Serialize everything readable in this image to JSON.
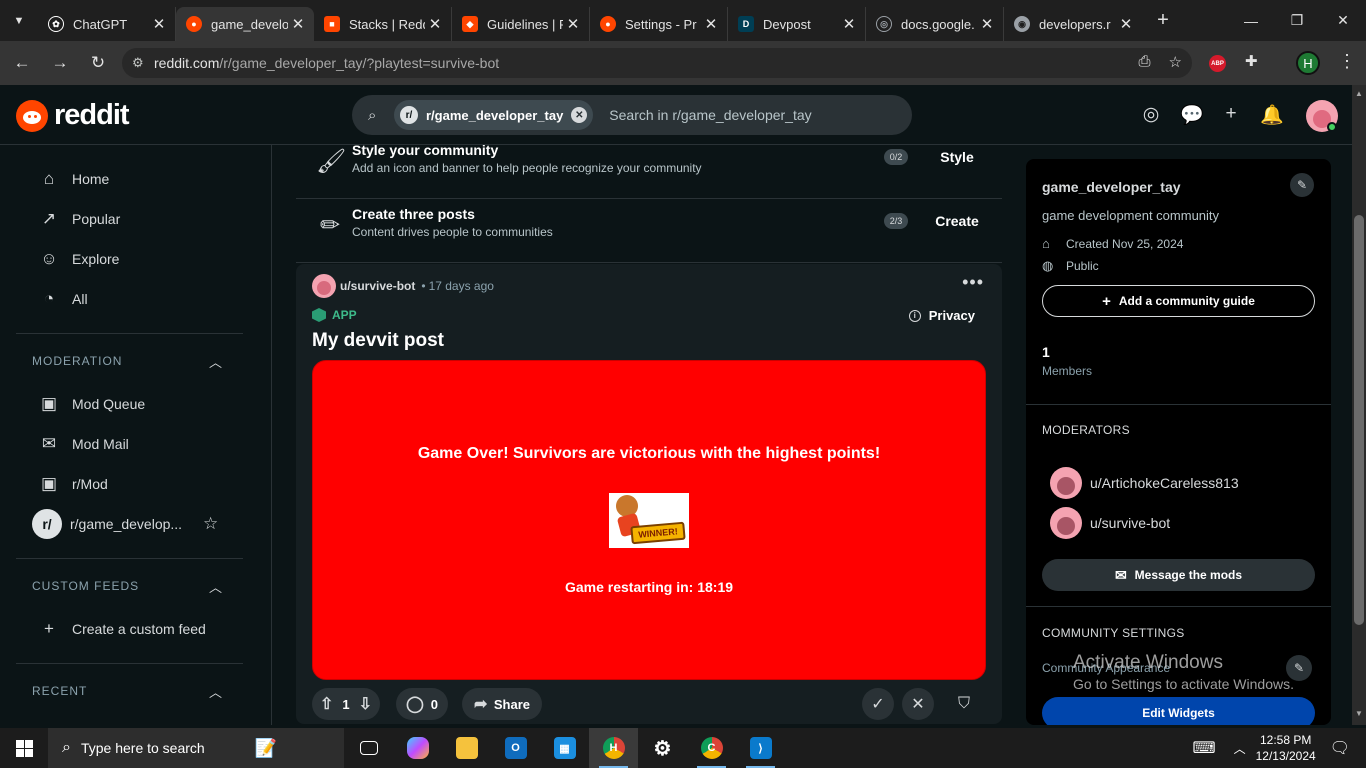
{
  "browser": {
    "tabs": [
      {
        "title": "ChatGPT",
        "icon": "chatgpt-icon",
        "color": "#ffffff",
        "active": false
      },
      {
        "title": "game_developer",
        "icon": "reddit-icon",
        "color": "#ff4500",
        "active": true
      },
      {
        "title": "Stacks | Reddit",
        "icon": "stacks-icon",
        "color": "#ff4500",
        "active": false
      },
      {
        "title": "Guidelines | R",
        "icon": "guidelines-icon",
        "color": "#ff4500",
        "active": false
      },
      {
        "title": "Settings - Pr",
        "icon": "reddit-icon",
        "color": "#ff4500",
        "active": false
      },
      {
        "title": "Devpost",
        "icon": "devpost-icon",
        "color": "#003e54",
        "active": false
      },
      {
        "title": "docs.google.",
        "icon": "globe-icon",
        "color": "#9aa0a6",
        "active": false
      },
      {
        "title": "developers.r",
        "icon": "github-icon",
        "color": "#9aa0a6",
        "active": false
      }
    ],
    "url_host": "reddit.com",
    "url_path": "/r/game_developer_tay/?playtest=survive-bot",
    "profile_initial": "H",
    "abp_label": "ABP"
  },
  "header": {
    "logo_text": "reddit",
    "search_chip": "r/game_developer_tay",
    "search_placeholder": "Search in r/game_developer_tay"
  },
  "sidebar": {
    "nav": [
      {
        "label": "Home",
        "icon": "home-icon"
      },
      {
        "label": "Popular",
        "icon": "popular-icon"
      },
      {
        "label": "Explore",
        "icon": "explore-icon"
      },
      {
        "label": "All",
        "icon": "all-icon"
      }
    ],
    "moderation_title": "MODERATION",
    "moderation": [
      {
        "label": "Mod Queue",
        "icon": "mod-queue-icon"
      },
      {
        "label": "Mod Mail",
        "icon": "mod-mail-icon"
      },
      {
        "label": "r/Mod",
        "icon": "r-mod-icon"
      },
      {
        "label": "r/game_develop...",
        "icon": "subreddit-avatar"
      }
    ],
    "custom_feeds_title": "CUSTOM FEEDS",
    "create_feed": "Create a custom feed",
    "recent_title": "RECENT"
  },
  "guides": [
    {
      "title": "Style your community",
      "desc": "Add an icon and banner to help people recognize your community",
      "badge": "0/2",
      "button": "Style"
    },
    {
      "title": "Create three posts",
      "desc": "Content drives people to communities",
      "badge": "2/3",
      "button": "Create"
    }
  ],
  "post": {
    "author": "u/survive-bot",
    "age": "17 days ago",
    "app_label": "APP",
    "privacy": "Privacy",
    "title": "My devvit post",
    "game_message": "Game Over! Survivors are victorious with the highest points!",
    "winner_text": "WINNER!",
    "timer": "Game restarting in: 18:19",
    "votes": "1",
    "comments": "0",
    "share": "Share"
  },
  "community": {
    "name": "game_developer_tay",
    "description": "game development community",
    "created": "Created Nov 25, 2024",
    "visibility": "Public",
    "guide_button": "Add a community guide",
    "members_count": "1",
    "members_label": "Members",
    "moderators_title": "MODERATORS",
    "moderators": [
      "u/ArtichokeCareless813",
      "u/survive-bot"
    ],
    "message_button": "Message the mods",
    "settings_title": "COMMUNITY SETTINGS",
    "appearance_label": "Community Appearance",
    "edit_widgets": "Edit Widgets"
  },
  "watermark": {
    "line1": "Activate Windows",
    "line2": "Go to Settings to activate Windows."
  },
  "taskbar": {
    "search_placeholder": "Type here to search",
    "time": "12:58 PM",
    "date": "12/13/2024"
  }
}
